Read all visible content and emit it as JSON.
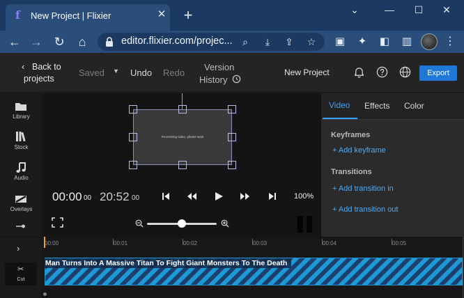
{
  "browser": {
    "tab_title": "New Project | Flixier",
    "url": "editor.flixier.com/projec..."
  },
  "header": {
    "back_line1": "Back to",
    "back_line2": "projects",
    "saved": "Saved",
    "undo": "Undo",
    "redo": "Redo",
    "version_line1": "Version",
    "version_line2": "History",
    "project_name": "New Project",
    "export": "Export"
  },
  "sidebar": {
    "items": [
      {
        "label": "Library",
        "icon": "folder-icon"
      },
      {
        "label": "Stock",
        "icon": "stock-books-icon"
      },
      {
        "label": "Audio",
        "icon": "music-note-icon"
      },
      {
        "label": "Overlays",
        "icon": "overlays-icon"
      }
    ]
  },
  "preview": {
    "processing_message": "Processing video, please wait!",
    "current_time": "00:00",
    "current_frames": "00",
    "total_time": "20:52",
    "total_frames": "00",
    "zoom_percent": "100%",
    "zoom_slider_level": 0.5
  },
  "right_panel": {
    "tabs": [
      "Video",
      "Effects",
      "Color"
    ],
    "active_tab": "Video",
    "keyframes_heading": "Keyframes",
    "add_keyframe": "Add keyframe",
    "transitions_heading": "Transitions",
    "add_transition_in": "Add transition in",
    "add_transition_out": "Add transition out"
  },
  "timeline": {
    "ruler_labels": [
      "00:00",
      "00:01",
      "00:02",
      "00:03",
      "00:04",
      "00:05"
    ],
    "clip_title": "Man Turns Into A Massive Titan To Fight Giant Monsters To The Death",
    "cut_label": "Cut"
  },
  "colors": {
    "accent": "#1f78d8",
    "link": "#54a8ef",
    "clip_stripe": "#1d9ad6",
    "playhead": "#f0a030"
  }
}
